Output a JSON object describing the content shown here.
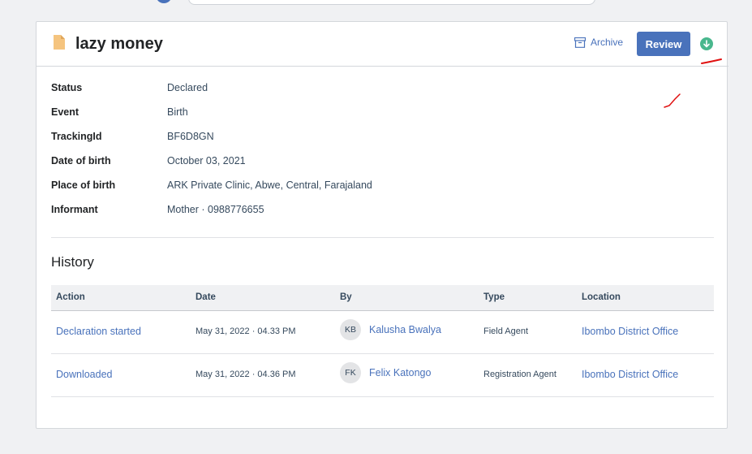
{
  "record": {
    "title": "lazy money",
    "archive_label": "Archive",
    "review_label": "Review"
  },
  "details": [
    {
      "label": "Status",
      "value": "Declared"
    },
    {
      "label": "Event",
      "value": "Birth"
    },
    {
      "label": "TrackingId",
      "value": "BF6D8GN"
    },
    {
      "label": "Date of birth",
      "value": "October 03, 2021"
    },
    {
      "label": "Place of birth",
      "value": "ARK Private Clinic, Abwe, Central, Farajaland"
    },
    {
      "label": "Informant",
      "value": "Mother · 0988776655"
    }
  ],
  "history": {
    "title": "History",
    "columns": [
      "Action",
      "Date",
      "By",
      "Type",
      "Location"
    ],
    "rows": [
      {
        "action": "Declaration started",
        "date": "May 31, 2022 · 04.33 PM",
        "initials": "KB",
        "by": "Kalusha Bwalya",
        "type": "Field Agent",
        "location": "Ibombo District Office"
      },
      {
        "action": "Downloaded",
        "date": "May 31, 2022 · 04.36 PM",
        "initials": "FK",
        "by": "Felix Katongo",
        "type": "Registration Agent",
        "location": "Ibombo District Office"
      }
    ]
  },
  "colors": {
    "accent": "#4972bb",
    "download_green": "#49b78d",
    "doc_icon": "#f5c47f",
    "annotation_red": "#e01010"
  },
  "icons": [
    "document-icon",
    "archive-icon",
    "download-icon"
  ]
}
